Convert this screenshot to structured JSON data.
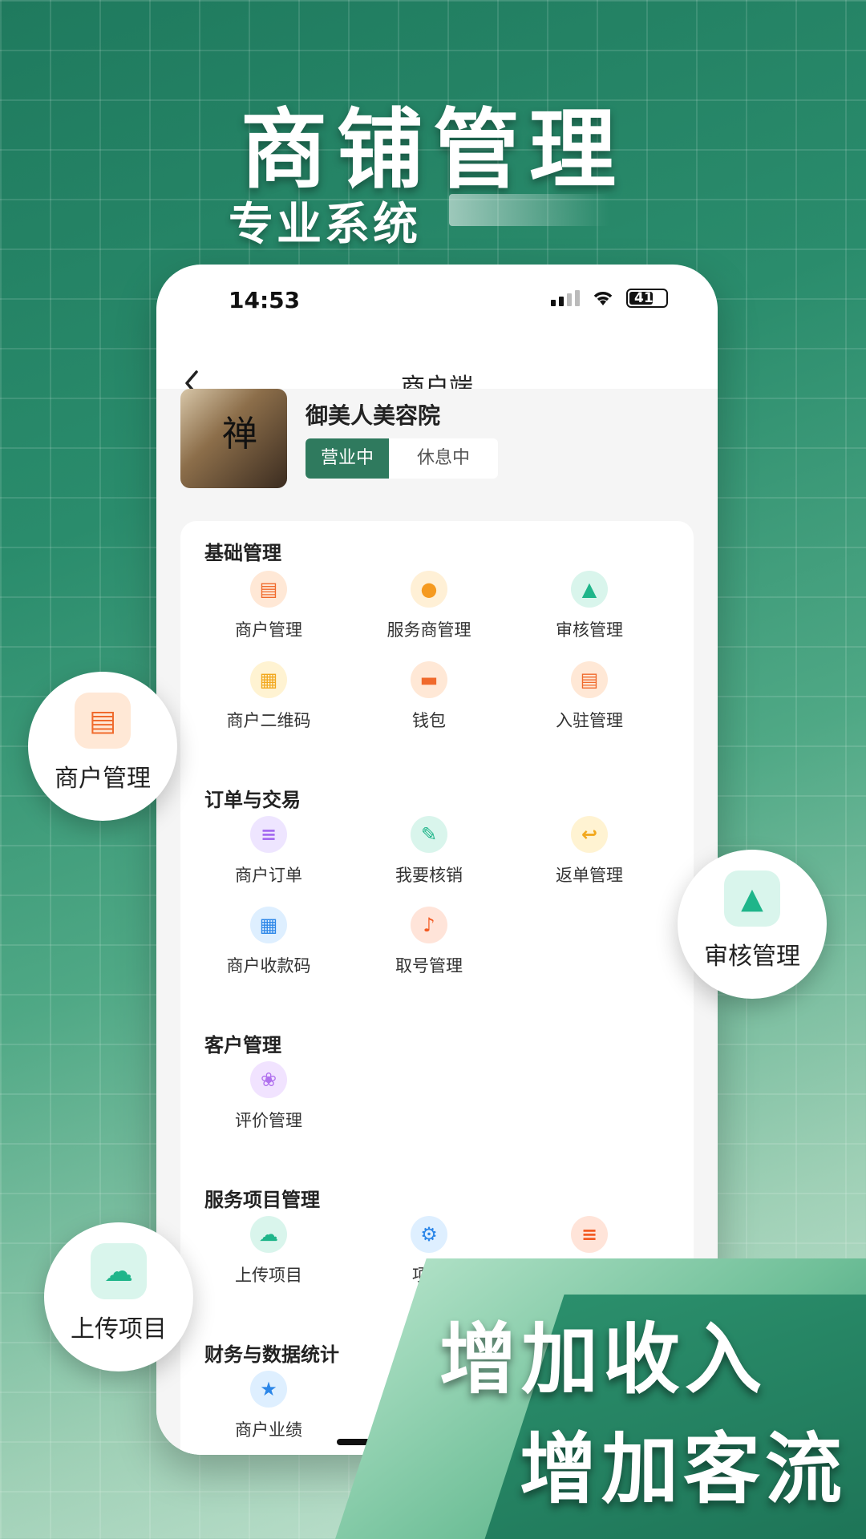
{
  "promo": {
    "headline": "商铺管理",
    "subline": "专业系统"
  },
  "status_bar": {
    "time": "14:53",
    "battery": "41"
  },
  "nav": {
    "title": "商户端",
    "back_icon": "chevron-left-icon"
  },
  "shop": {
    "name": "御美人美容院",
    "status_open": "营业中",
    "status_rest": "休息中",
    "selected_status": "营业中"
  },
  "sections": {
    "basic": {
      "title": "基础管理",
      "items": [
        "商户管理",
        "服务商管理",
        "审核管理",
        "商户二维码",
        "钱包",
        "入驻管理"
      ]
    },
    "orders": {
      "title": "订单与交易",
      "items": [
        "商户订单",
        "我要核销",
        "返单管理",
        "商户收款码",
        "取号管理"
      ]
    },
    "customers": {
      "title": "客户管理",
      "items": [
        "评价管理"
      ]
    },
    "services": {
      "title": "服务项目管理",
      "items": [
        "上传项目",
        "项目"
      ]
    },
    "finance": {
      "title": "财务与数据统计",
      "items": [
        "商户业绩"
      ]
    }
  },
  "bubbles": {
    "merchant": "商户管理",
    "audit": "审核管理",
    "upload": "上传项目"
  },
  "slogans": [
    "增加收入",
    "增加客流"
  ],
  "colors": {
    "brand_green": "#2f7a5e",
    "accent_orange": "#f06a2c"
  }
}
